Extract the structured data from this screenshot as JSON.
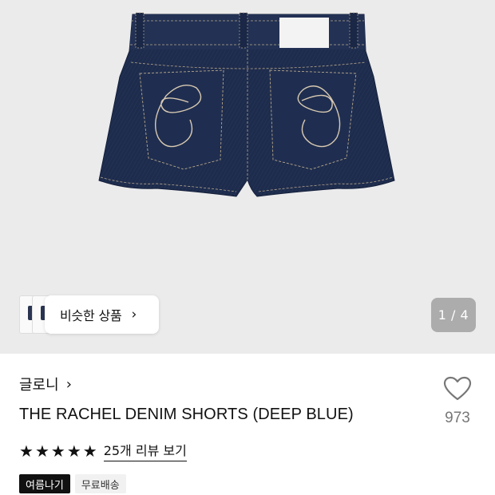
{
  "gallery": {
    "similar_label": "비슷한 상품",
    "chevron_glyph": "›",
    "counter": "1 / 4",
    "image_colors": {
      "denim": "#1c2a4a",
      "background": "#ebebec"
    }
  },
  "product": {
    "brand": "글로니",
    "brand_chevron": "›",
    "title": "THE RACHEL DENIM SHORTS (DEEP BLUE)",
    "likes": "973",
    "stars": [
      "★",
      "★",
      "★",
      "★",
      "★"
    ],
    "review_link": "25개 리뷰 보기",
    "tags": [
      "여름나기",
      "무료배송"
    ]
  }
}
